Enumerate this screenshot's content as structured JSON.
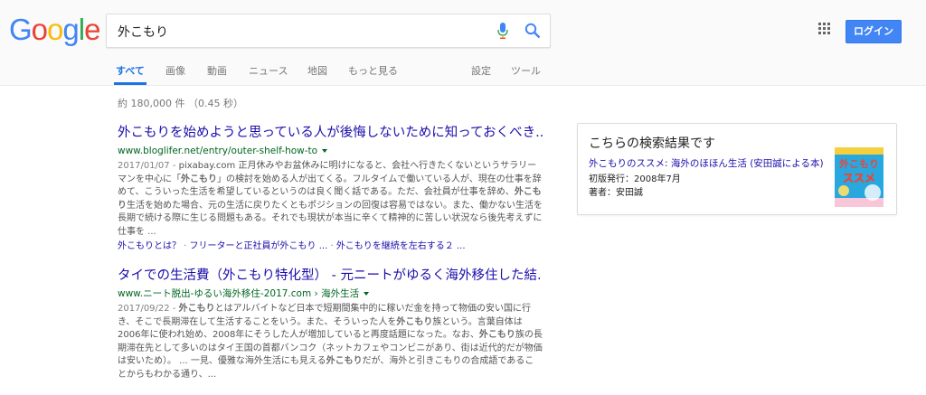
{
  "header": {
    "logo_letters": [
      "G",
      "o",
      "o",
      "g",
      "l",
      "e"
    ],
    "logo_colors": [
      "#4285f4",
      "#ea4335",
      "#fbbc05",
      "#4285f4",
      "#34a853",
      "#ea4335"
    ],
    "search_value": "外こもり",
    "login_label": "ログイン",
    "accent_color": "#4285f4"
  },
  "tabs": {
    "all": "すべて",
    "images": "画像",
    "videos": "動画",
    "news": "ニュース",
    "maps": "地図",
    "more": "もっと見る",
    "settings": "設定",
    "tools": "ツール"
  },
  "stats": "約 180,000 件 （0.45 秒）",
  "results": [
    {
      "title": "外こもりを始めようと思っている人が後悔しないために知っておくべき...",
      "url": "www.bloglifer.net/entry/outer-shelf-how-to",
      "date": "2017/01/07 - ",
      "s1": "pixabay.com 正月休みやお盆休みに明けになると、会社へ行きたくないというサラリーマンを中心に「",
      "b1": "外こもり",
      "s2": "」の検討を始める人が出てくる。フルタイムで働いている人が、現在の仕事を辞めて、こういった生活を希望しているというのは良く聞く話である。ただ、会社員が仕事を辞め、",
      "b2": "外こもり",
      "s3": "生活を始めた場合、元の生活に戻りたくともポジションの回復は容易ではない。また、働かない生活を長期で続ける際に生じる問題もある。それでも現状が本当に辛くて精神的に苦しい状況なら後先考えずに仕事を ...",
      "link1": "外こもりとは？",
      "link2": "フリーターと正社員が外こもり ...",
      "link3": "外こもりを継続を左右する２ ..."
    },
    {
      "title": "タイでの生活費（外こもり特化型） - 元ニートがゆるく海外移住した結...",
      "url": "www.ニート脱出-ゆるい海外移住-2017.com › 海外生活",
      "date": "2017/09/22 - ",
      "b1": "外こもり",
      "s1": "とはアルバイトなど日本で短期間集中的に稼いだ金を持って物価の安い国に行き、そこで長期滞在して生活することをいう。また、そういった人を",
      "b2": "外こもり",
      "s2": "族という。言葉自体は2006年に使われ始め、2008年にそうした人が増加していると再度話題になった。なお、",
      "b3": "外こもり",
      "s3": "族の長期滞在先として多いのはタイ王国の首都バンコク（ネットカフェやコンビニがあり、街は近代的だが物価は安いため）。 ... 一見、優雅な海外生活にも見える",
      "b4": "外こもり",
      "s4": "だが、海外と引きこもりの合成語であることからもわかる通り、..."
    }
  ],
  "knowledge_panel": {
    "heading": "こちらの検索結果です",
    "book_title": "外こもりのススメ: 海外のほほん生活 (安田誠による本)",
    "published_label": "初版発行：",
    "published_value": "2008年7月",
    "author_label": "著者：",
    "author_value": "安田誠",
    "cover_text1": "外こもり",
    "cover_text2": "ススメ"
  }
}
